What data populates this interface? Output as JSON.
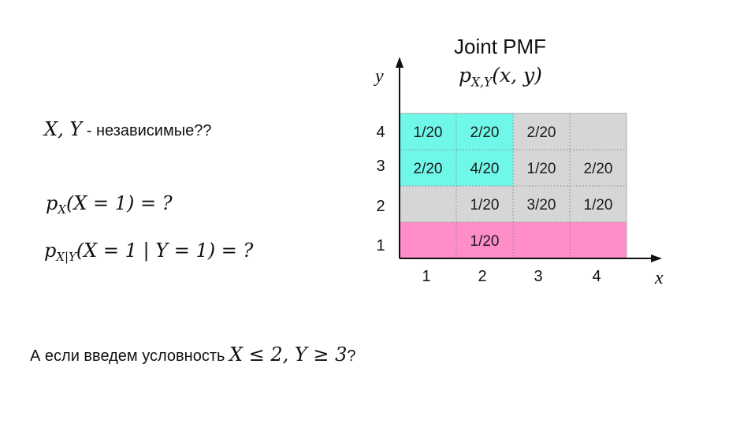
{
  "title": "Joint PMF",
  "formula": {
    "base": "p",
    "sub": "X,Y",
    "args": "(x, y)"
  },
  "questions": {
    "independent": {
      "vars": "X, Y",
      "text": " - независимые??"
    },
    "px": "(X = 1) = ?",
    "px_sub": "X",
    "pxy_sub": "X|Y",
    "pxy": "(X = 1 | Y = 1) = ?",
    "condition_text": "А если введем условность ",
    "condition_math": "X ≤ 2,  Y ≥ 3",
    "condition_end": "?"
  },
  "colors": {
    "cyan": "#6ff7e8",
    "gray": "#d6d6d6",
    "pink": "#ff8ec8",
    "grid_line": "#888888",
    "axis": "#111111"
  },
  "chart_data": {
    "type": "table",
    "xlabel": "x",
    "ylabel": "y",
    "x_ticks": [
      "1",
      "2",
      "3",
      "4"
    ],
    "y_ticks": [
      "4",
      "3",
      "2",
      "1"
    ],
    "rows": [
      {
        "y": "4",
        "cells": [
          {
            "x": "1",
            "label": "1/20",
            "fill": "cyan"
          },
          {
            "x": "2",
            "label": "2/20",
            "fill": "cyan"
          },
          {
            "x": "3",
            "label": "2/20",
            "fill": "gray"
          },
          {
            "x": "4",
            "label": "",
            "fill": "gray"
          }
        ]
      },
      {
        "y": "3",
        "cells": [
          {
            "x": "1",
            "label": "2/20",
            "fill": "cyan"
          },
          {
            "x": "2",
            "label": "4/20",
            "fill": "cyan"
          },
          {
            "x": "3",
            "label": "1/20",
            "fill": "gray"
          },
          {
            "x": "4",
            "label": "2/20",
            "fill": "gray"
          }
        ]
      },
      {
        "y": "2",
        "cells": [
          {
            "x": "1",
            "label": "",
            "fill": "gray"
          },
          {
            "x": "2",
            "label": "1/20",
            "fill": "gray"
          },
          {
            "x": "3",
            "label": "3/20",
            "fill": "gray"
          },
          {
            "x": "4",
            "label": "1/20",
            "fill": "gray"
          }
        ]
      },
      {
        "y": "1",
        "cells": [
          {
            "x": "1",
            "label": "",
            "fill": "pink"
          },
          {
            "x": "2",
            "label": "1/20",
            "fill": "pink"
          },
          {
            "x": "3",
            "label": "",
            "fill": "pink"
          },
          {
            "x": "4",
            "label": "",
            "fill": "pink"
          }
        ]
      }
    ]
  }
}
